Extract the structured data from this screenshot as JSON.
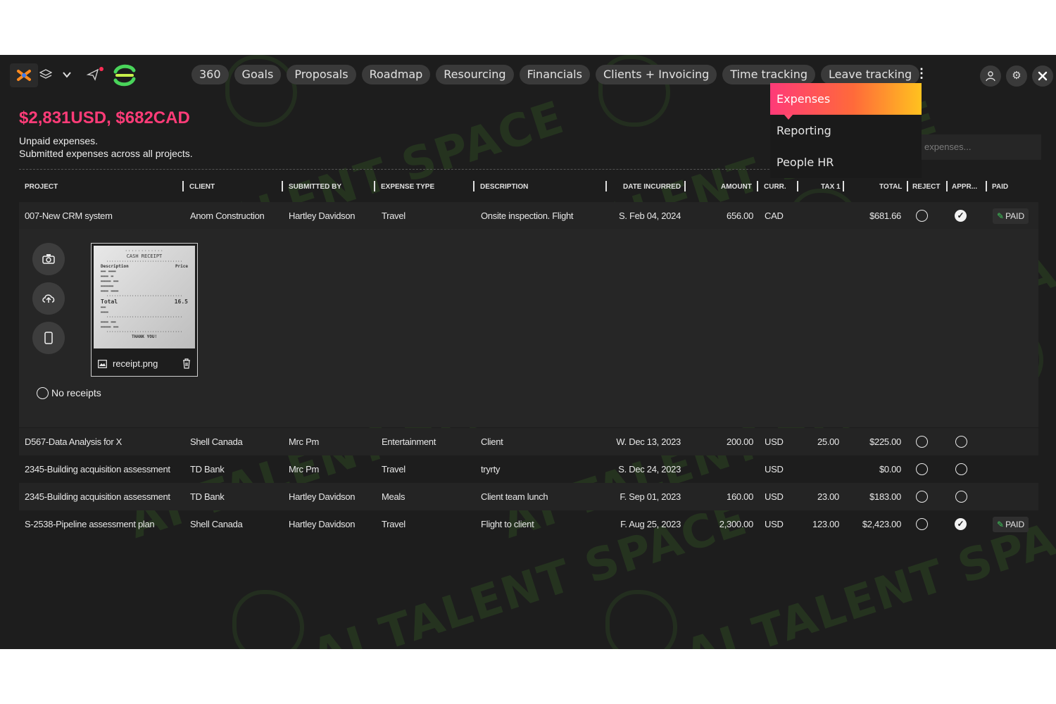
{
  "toolbar": {
    "icons": [
      "apps-icon",
      "layers-icon",
      "chevron-down-icon",
      "send-icon",
      "brand-logo"
    ],
    "tabs": [
      "360",
      "Goals",
      "Proposals",
      "Roadmap",
      "Resourcing",
      "Financials",
      "Clients + Invoicing",
      "Time tracking",
      "Leave tracking"
    ],
    "right_icons": [
      "user-icon",
      "gear-icon",
      "close-icon"
    ]
  },
  "dropdown": {
    "items": [
      "Expenses",
      "Reporting",
      "People HR"
    ],
    "active": "Expenses"
  },
  "search": {
    "placeholder": "expenses..."
  },
  "summary": {
    "totals": "$2,831USD, $682CAD",
    "line1": "Unpaid expenses.",
    "line2": "Submitted expenses across all projects."
  },
  "table": {
    "headers": [
      "PROJECT",
      "CLIENT",
      "SUBMITTED BY",
      "EXPENSE TYPE",
      "DESCRIPTION",
      "DATE INCURRED",
      "AMOUNT",
      "CURR.",
      "TAX 1",
      "TOTAL",
      "REJECT",
      "APPR...",
      "PAID"
    ],
    "rows": [
      {
        "project": "007-New CRM system",
        "client": "Anom Construction",
        "submitted_by": "Hartley Davidson",
        "type": "Travel",
        "description": "Onsite inspection. Flight",
        "date": "S. Feb 04, 2024",
        "amount": "656.00",
        "curr": "CAD",
        "tax": "",
        "total": "$681.66",
        "approved": true,
        "paid": "PAID"
      },
      {
        "project": "D567-Data Analysis for X",
        "client": "Shell Canada",
        "submitted_by": "Mrc Pm",
        "type": "Entertainment",
        "description": "Client",
        "date": "W. Dec 13, 2023",
        "amount": "200.00",
        "curr": "USD",
        "tax": "25.00",
        "total": "$225.00",
        "approved": false,
        "paid": ""
      },
      {
        "project": "2345-Building acquisition assessment",
        "client": "TD Bank",
        "submitted_by": "Mrc Pm",
        "type": "Travel",
        "description": "tryrty",
        "date": "S. Dec 24, 2023",
        "amount": "",
        "curr": "USD",
        "tax": "",
        "total": "$0.00",
        "approved": false,
        "paid": ""
      },
      {
        "project": "2345-Building acquisition assessment",
        "client": "TD Bank",
        "submitted_by": "Hartley Davidson",
        "type": "Meals",
        "description": "Client team lunch",
        "date": "F. Sep 01, 2023",
        "amount": "160.00",
        "curr": "USD",
        "tax": "23.00",
        "total": "$183.00",
        "approved": false,
        "paid": ""
      },
      {
        "project": "S-2538-Pipeline assessment plan",
        "client": "Shell Canada",
        "submitted_by": "Hartley Davidson",
        "type": "Travel",
        "description": "Flight to client",
        "date": "F. Aug 25, 2023",
        "amount": "2,300.00",
        "curr": "USD",
        "tax": "123.00",
        "total": "$2,423.00",
        "approved": true,
        "paid": "PAID"
      }
    ]
  },
  "attachment": {
    "filename": "receipt.png",
    "no_receipts_label": "No receipts",
    "side_icons": [
      "camera-icon",
      "cloud-upload-icon",
      "phone-icon"
    ],
    "receipt_text": {
      "title": "CASH RECEIPT",
      "description": "Description",
      "price": "Price",
      "total": "Total",
      "total_value": "16.5",
      "thanks": "THANK YOU!"
    }
  },
  "watermark": "AI TALENT SPACE",
  "colors": {
    "accent": "#ff3c78",
    "gradient": [
      "#ff3a78",
      "#ff6a3a",
      "#ffc21f"
    ],
    "background": "#1d1d1d",
    "paid_leaf": "#3ecb5a"
  }
}
